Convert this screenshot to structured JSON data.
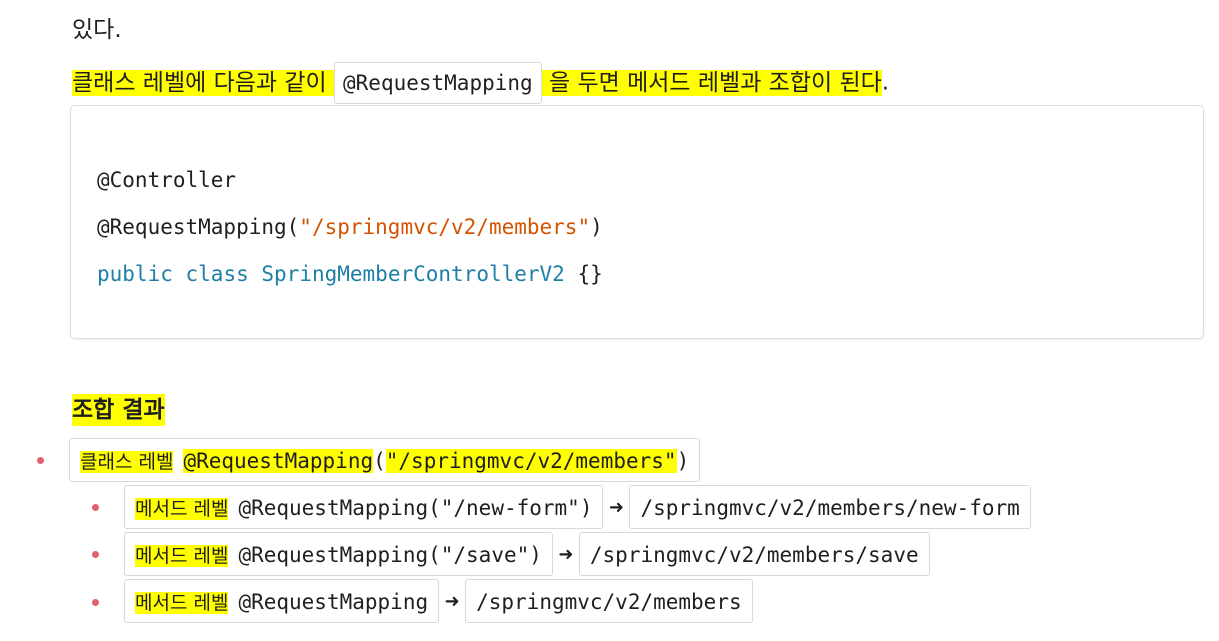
{
  "paragraph": {
    "line1": "있다.",
    "line2_before": "클래스 레벨에 다음과 같이",
    "line2_code": "@RequestMapping",
    "line2_after": "을 두면 메서드 레벨과 조합이 된다",
    "line2_period": "."
  },
  "code_block": {
    "line1": "@Controller",
    "line2_prefix": "@RequestMapping(",
    "line2_string": "\"/springmvc/v2/members\"",
    "line2_suffix": ")",
    "line3_kw1": "public",
    "line3_kw2": "class",
    "line3_name": "SpringMemberControllerV2",
    "line3_rest": "{}"
  },
  "section": {
    "heading": "조합 결과"
  },
  "results": {
    "class_level": {
      "label": "클래스 레벨",
      "annotation": "@RequestMapping",
      "open": "(",
      "path": "\"/springmvc/v2/members\"",
      "close": ")"
    },
    "items": [
      {
        "label": "메서드 레벨",
        "annotation": "@RequestMapping(\"/new-form\")",
        "arrow": "➜",
        "result": "/springmvc/v2/members/new-form"
      },
      {
        "label": "메서드 레벨",
        "annotation": "@RequestMapping(\"/save\")",
        "arrow": "➜",
        "result": "/springmvc/v2/members/save"
      },
      {
        "label": "메서드 레벨",
        "annotation": "@RequestMapping",
        "arrow": "➜",
        "result": "/springmvc/v2/members"
      }
    ]
  },
  "colors": {
    "highlight": "#ffff00",
    "string": "#d35400",
    "keyword": "#1e7fa6",
    "bullet": "#e06070"
  }
}
